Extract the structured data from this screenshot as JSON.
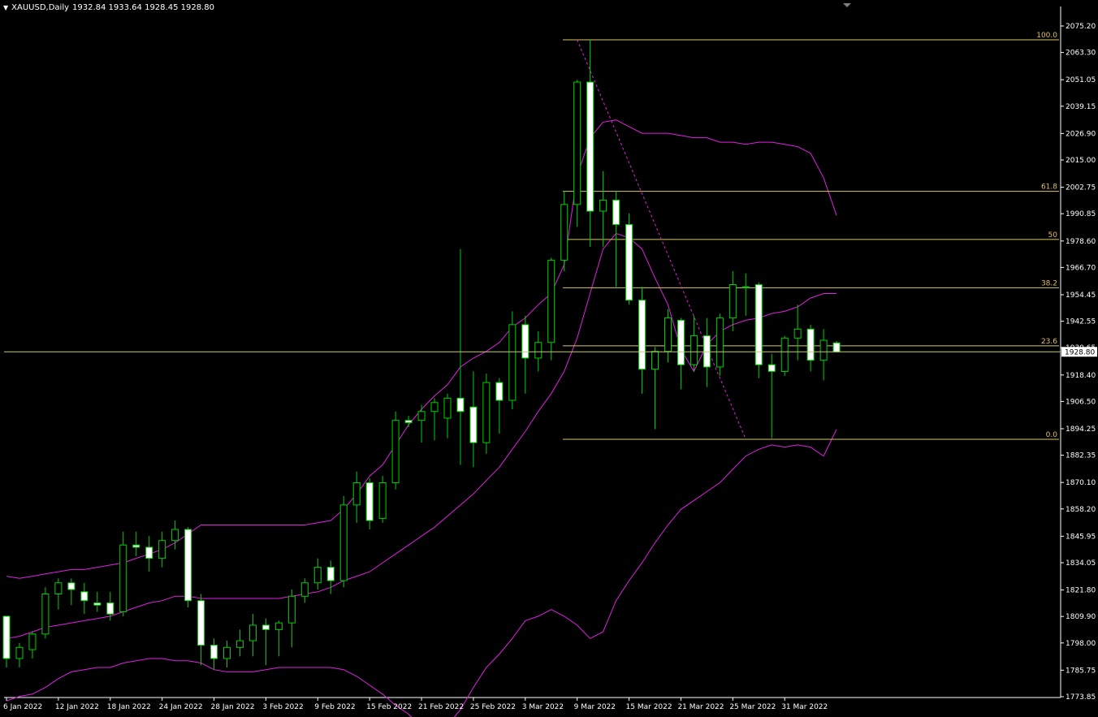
{
  "header": {
    "symbol": "XAUUSD,Daily",
    "ohlc": "1932.84 1933.64 1928.45 1928.80",
    "caret_icon": "caret-down-icon"
  },
  "colors": {
    "background": "#000000",
    "bull_candle": "#00d000",
    "bear_candle_fill": "#ffffff",
    "bollinger": "#e020e0",
    "fib": "#d8c860",
    "fib_text": "#e0c060",
    "trendline": "#e020e0",
    "price_line": "#c8c880",
    "axis_text": "#ffffff",
    "axis_line": "#ffffff"
  },
  "chart_data": {
    "type": "candlestick",
    "ylim": [
      1770.5,
      2083.0
    ],
    "y_ticks": [
      "2075.20",
      "2063.30",
      "2051.05",
      "2039.15",
      "2026.90",
      "2015.00",
      "2002.75",
      "1990.85",
      "1978.60",
      "1966.70",
      "1954.45",
      "1942.55",
      "1930.65",
      "1918.40",
      "1906.50",
      "1894.25",
      "1882.35",
      "1870.10",
      "1858.20",
      "1845.95",
      "1834.05",
      "1821.80",
      "1809.90",
      "1798.00",
      "1785.75",
      "1773.85"
    ],
    "x_labels": [
      {
        "label": "6 Jan 2022",
        "i": 0
      },
      {
        "label": "12 Jan 2022",
        "i": 4
      },
      {
        "label": "18 Jan 2022",
        "i": 8
      },
      {
        "label": "24 Jan 2022",
        "i": 12
      },
      {
        "label": "28 Jan 2022",
        "i": 16
      },
      {
        "label": "3 Feb 2022",
        "i": 20
      },
      {
        "label": "9 Feb 2022",
        "i": 24
      },
      {
        "label": "15 Feb 2022",
        "i": 28
      },
      {
        "label": "21 Feb 2022",
        "i": 32
      },
      {
        "label": "25 Feb 2022",
        "i": 36
      },
      {
        "label": "3 Mar 2022",
        "i": 40
      },
      {
        "label": "9 Mar 2022",
        "i": 44
      },
      {
        "label": "15 Mar 2022",
        "i": 48
      },
      {
        "label": "21 Mar 2022",
        "i": 52
      },
      {
        "label": "25 Mar 2022",
        "i": 56
      },
      {
        "label": "31 Mar 2022",
        "i": 60
      }
    ],
    "candles": [
      {
        "o": 1810,
        "h": 1810,
        "l": 1787,
        "c": 1791
      },
      {
        "o": 1791,
        "h": 1798,
        "l": 1787,
        "c": 1796
      },
      {
        "o": 1795,
        "h": 1803,
        "l": 1791,
        "c": 1802
      },
      {
        "o": 1802,
        "h": 1823,
        "l": 1800,
        "c": 1820
      },
      {
        "o": 1820,
        "h": 1827,
        "l": 1813,
        "c": 1825
      },
      {
        "o": 1825,
        "h": 1827,
        "l": 1815,
        "c": 1822
      },
      {
        "o": 1821,
        "h": 1825,
        "l": 1811,
        "c": 1817
      },
      {
        "o": 1816,
        "h": 1821,
        "l": 1812,
        "c": 1815
      },
      {
        "o": 1816,
        "h": 1821,
        "l": 1808,
        "c": 1811
      },
      {
        "o": 1812,
        "h": 1848,
        "l": 1810,
        "c": 1842
      },
      {
        "o": 1842,
        "h": 1848,
        "l": 1837,
        "c": 1841
      },
      {
        "o": 1841,
        "h": 1846,
        "l": 1830,
        "c": 1836
      },
      {
        "o": 1836,
        "h": 1848,
        "l": 1832,
        "c": 1844
      },
      {
        "o": 1844,
        "h": 1853,
        "l": 1840,
        "c": 1849
      },
      {
        "o": 1849,
        "h": 1850,
        "l": 1814,
        "c": 1817
      },
      {
        "o": 1817,
        "h": 1820,
        "l": 1788,
        "c": 1797
      },
      {
        "o": 1797,
        "h": 1800,
        "l": 1786,
        "c": 1791
      },
      {
        "o": 1791,
        "h": 1799,
        "l": 1787,
        "c": 1796
      },
      {
        "o": 1796,
        "h": 1804,
        "l": 1792,
        "c": 1799
      },
      {
        "o": 1799,
        "h": 1811,
        "l": 1792,
        "c": 1806
      },
      {
        "o": 1806,
        "h": 1809,
        "l": 1788,
        "c": 1804
      },
      {
        "o": 1804,
        "h": 1808,
        "l": 1792,
        "c": 1807
      },
      {
        "o": 1807,
        "h": 1822,
        "l": 1796,
        "c": 1819
      },
      {
        "o": 1819,
        "h": 1827,
        "l": 1816,
        "c": 1825
      },
      {
        "o": 1825,
        "h": 1836,
        "l": 1822,
        "c": 1832
      },
      {
        "o": 1832,
        "h": 1835,
        "l": 1820,
        "c": 1826
      },
      {
        "o": 1826,
        "h": 1864,
        "l": 1823,
        "c": 1860
      },
      {
        "o": 1860,
        "h": 1875,
        "l": 1852,
        "c": 1870
      },
      {
        "o": 1870,
        "h": 1872,
        "l": 1849,
        "c": 1853
      },
      {
        "o": 1854,
        "h": 1873,
        "l": 1852,
        "c": 1870
      },
      {
        "o": 1870,
        "h": 1902,
        "l": 1867,
        "c": 1898
      },
      {
        "o": 1898,
        "h": 1900,
        "l": 1895,
        "c": 1897
      },
      {
        "o": 1898,
        "h": 1905,
        "l": 1888,
        "c": 1902
      },
      {
        "o": 1902,
        "h": 1908,
        "l": 1889,
        "c": 1906
      },
      {
        "o": 1899,
        "h": 1910,
        "l": 1890,
        "c": 1908
      },
      {
        "o": 1908,
        "h": 1975,
        "l": 1878,
        "c": 1902
      },
      {
        "o": 1904,
        "h": 1920,
        "l": 1877,
        "c": 1888
      },
      {
        "o": 1888,
        "h": 1919,
        "l": 1883,
        "c": 1915
      },
      {
        "o": 1915,
        "h": 1917,
        "l": 1892,
        "c": 1907
      },
      {
        "o": 1907,
        "h": 1947,
        "l": 1903,
        "c": 1941
      },
      {
        "o": 1941,
        "h": 1945,
        "l": 1910,
        "c": 1926
      },
      {
        "o": 1926,
        "h": 1938,
        "l": 1920,
        "c": 1933
      },
      {
        "o": 1933,
        "h": 1971,
        "l": 1925,
        "c": 1970
      },
      {
        "o": 1970,
        "h": 2001,
        "l": 1965,
        "c": 1995
      },
      {
        "o": 1995,
        "h": 2051,
        "l": 1985,
        "c": 2050
      },
      {
        "o": 2050,
        "h": 2069,
        "l": 1976,
        "c": 1992
      },
      {
        "o": 1992,
        "h": 2010,
        "l": 1976,
        "c": 1997
      },
      {
        "o": 1997,
        "h": 2001,
        "l": 1958,
        "c": 1986
      },
      {
        "o": 1986,
        "h": 1991,
        "l": 1950,
        "c": 1952
      },
      {
        "o": 1952,
        "h": 1958,
        "l": 1910,
        "c": 1921
      },
      {
        "o": 1921,
        "h": 1931,
        "l": 1894,
        "c": 1929
      },
      {
        "o": 1929,
        "h": 1948,
        "l": 1924,
        "c": 1944
      },
      {
        "o": 1943,
        "h": 1944,
        "l": 1912,
        "c": 1923
      },
      {
        "o": 1923,
        "h": 1945,
        "l": 1920,
        "c": 1936
      },
      {
        "o": 1936,
        "h": 1944,
        "l": 1913,
        "c": 1922
      },
      {
        "o": 1922,
        "h": 1946,
        "l": 1918,
        "c": 1944
      },
      {
        "o": 1944,
        "h": 1965,
        "l": 1938,
        "c": 1959
      },
      {
        "o": 1958,
        "h": 1964,
        "l": 1945,
        "c": 1958
      },
      {
        "o": 1959,
        "h": 1960,
        "l": 1917,
        "c": 1923
      },
      {
        "o": 1923,
        "h": 1928,
        "l": 1890,
        "c": 1920
      },
      {
        "o": 1920,
        "h": 1936,
        "l": 1918,
        "c": 1935
      },
      {
        "o": 1935,
        "h": 1950,
        "l": 1925,
        "c": 1939
      },
      {
        "o": 1939,
        "h": 1941,
        "l": 1920,
        "c": 1925
      },
      {
        "o": 1925,
        "h": 1939,
        "l": 1916,
        "c": 1934
      },
      {
        "o": 1932.84,
        "h": 1933.64,
        "l": 1928.45,
        "c": 1928.8
      }
    ],
    "bollinger_upper": [
      1828,
      1827,
      1828,
      1829,
      1830,
      1831,
      1831,
      1832,
      1833,
      1834,
      1836,
      1838,
      1840,
      1843,
      1847,
      1851,
      1851,
      1851,
      1851,
      1851,
      1851,
      1851,
      1851,
      1851,
      1852,
      1853,
      1858,
      1865,
      1873,
      1878,
      1887,
      1896,
      1903,
      1909,
      1914,
      1922,
      1926,
      1929,
      1933,
      1940,
      1944,
      1950,
      1955,
      1968,
      2008,
      2025,
      2032,
      2033,
      2030,
      2027,
      2027,
      2027,
      2026,
      2025,
      2025,
      2023,
      2023,
      2022,
      2023,
      2023,
      2022,
      2021,
      2018,
      2007,
      1990
    ],
    "bollinger_middle": [
      1800,
      1801,
      1803,
      1805,
      1806,
      1807,
      1808,
      1809,
      1810,
      1812,
      1814,
      1816,
      1817,
      1819,
      1819,
      1818,
      1818,
      1818,
      1818,
      1818,
      1818,
      1818,
      1819,
      1820,
      1821,
      1823,
      1826,
      1828,
      1830,
      1834,
      1838,
      1842,
      1846,
      1850,
      1855,
      1860,
      1865,
      1871,
      1877,
      1885,
      1893,
      1902,
      1910,
      1920,
      1935,
      1955,
      1975,
      1982,
      1980,
      1975,
      1962,
      1950,
      1930,
      1920,
      1932,
      1938,
      1941,
      1943,
      1944,
      1946,
      1947,
      1949,
      1953,
      1955,
      1955
    ],
    "bollinger_lower": [
      1772,
      1774,
      1775,
      1778,
      1782,
      1785,
      1786,
      1787,
      1787,
      1789,
      1790,
      1791,
      1791,
      1790,
      1790,
      1789,
      1786,
      1785,
      1785,
      1785,
      1786,
      1787,
      1787,
      1787,
      1787,
      1787,
      1786,
      1783,
      1779,
      1775,
      1770,
      1766,
      1760,
      1755,
      1761,
      1768,
      1778,
      1787,
      1793,
      1800,
      1808,
      1810,
      1813,
      1810,
      1806,
      1800,
      1803,
      1817,
      1826,
      1834,
      1843,
      1851,
      1858,
      1862,
      1866,
      1870,
      1876,
      1882,
      1885,
      1887,
      1886,
      1887,
      1886,
      1882,
      1894
    ]
  },
  "fibonacci": {
    "anchor_high": 2069,
    "anchor_low": 1889.5,
    "levels": [
      {
        "label": "100.0",
        "value": 2069
      },
      {
        "label": "61.8",
        "value": 2000.9
      },
      {
        "label": "50",
        "value": 1979.3
      },
      {
        "label": "38.2",
        "value": 1957.6
      },
      {
        "label": "23.6",
        "value": 1931.5
      },
      {
        "label": "0.0",
        "value": 1889.5
      }
    ]
  },
  "trendline": {
    "start_i": 44,
    "start_v": 2069,
    "end_i": 57,
    "end_v": 1889.5
  },
  "price_line": {
    "value": 1928.8,
    "label": "1928.80"
  }
}
